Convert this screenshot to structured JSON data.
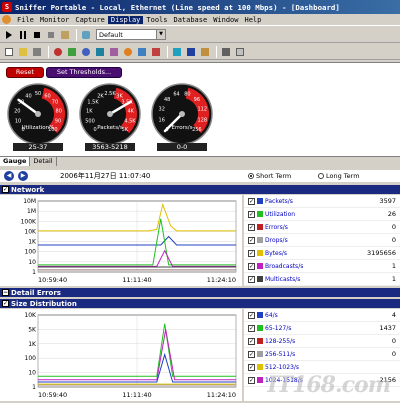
{
  "window": {
    "title": "Sniffer Portable - Local, Ethernet (Line speed at 100 Mbps) - [Dashboard]"
  },
  "menu": [
    "File",
    "Monitor",
    "Capture",
    "Display",
    "Tools",
    "Database",
    "Window",
    "Help"
  ],
  "toolbar": {
    "profile_value": "Default"
  },
  "gauge_panel": {
    "reset_label": "Reset",
    "thresholds_label": "Set Thresholds...",
    "gauges": [
      {
        "name": "Utilization%",
        "range": "25-37",
        "ticks": [
          "0",
          "10",
          "20",
          "30",
          "40",
          "50",
          "60",
          "70",
          "80",
          "90",
          "100"
        ]
      },
      {
        "name": "Packets/s",
        "range": "3563-5218",
        "ticks": [
          "0",
          "500",
          "1K",
          "1.5K",
          "2K",
          "2.5K",
          "3K",
          "3.5K",
          "4K",
          "4.5K",
          "5K"
        ]
      },
      {
        "name": "Errors/s",
        "range": "0-0",
        "ticks": [
          "0",
          "16",
          "32",
          "48",
          "64",
          "80",
          "96",
          "112",
          "128",
          "256"
        ]
      }
    ]
  },
  "tabs": [
    "Gauge",
    "Detail"
  ],
  "detail": {
    "timestamp": "2006年11月27日  11:07:40",
    "short_term": "Short Term",
    "long_term": "Long Term",
    "sections": [
      {
        "title": "Network",
        "collapsed": false
      },
      {
        "title": "Detail Errors",
        "collapsed": true
      },
      {
        "title": "Size Distribution",
        "collapsed": false
      }
    ]
  },
  "chart_data": [
    {
      "type": "line",
      "title": "Network",
      "x": [
        "10:59:40",
        "11:11:40",
        "11:24:10"
      ],
      "y_ticks": [
        "1",
        "10",
        "100",
        "1K",
        "10K",
        "100K",
        "1M",
        "10M"
      ],
      "series": [
        {
          "name": "Packets/s",
          "color": "#2040c0",
          "value": "3597"
        },
        {
          "name": "Utilization",
          "color": "#20c020",
          "value": "26"
        },
        {
          "name": "Errors/s",
          "color": "#c02020",
          "value": "0"
        },
        {
          "name": "Drops/s",
          "color": "#a0a0a0",
          "value": "0"
        },
        {
          "name": "Bytes/s",
          "color": "#e0c000",
          "value": "3195656"
        },
        {
          "name": "Broadcasts/s",
          "color": "#c020c0",
          "value": "1"
        },
        {
          "name": "Multicasts/s",
          "color": "#404040",
          "value": "1"
        }
      ]
    },
    {
      "type": "line",
      "title": "Size Distribution",
      "x": [
        "10:59:40",
        "11:11:40",
        "11:24:10"
      ],
      "y_ticks": [
        "1",
        "10",
        "100",
        "1K",
        "5K",
        "10K"
      ],
      "series": [
        {
          "name": "64/s",
          "color": "#2040c0",
          "value": "4"
        },
        {
          "name": "65-127/s",
          "color": "#20c020",
          "value": "1437"
        },
        {
          "name": "128-255/s",
          "color": "#c02020",
          "value": "0"
        },
        {
          "name": "256-511/s",
          "color": "#a0a0a0",
          "value": "0"
        },
        {
          "name": "512-1023/s",
          "color": "#e0c000",
          "value": ""
        },
        {
          "name": "1024-1518/s",
          "color": "#c020c0",
          "value": "2156"
        }
      ]
    }
  ],
  "watermark": "IT168.com",
  "colors": {
    "title_bar": "#0a246a",
    "section_header": "#1a2a80",
    "gauge_red": "#e02020"
  }
}
